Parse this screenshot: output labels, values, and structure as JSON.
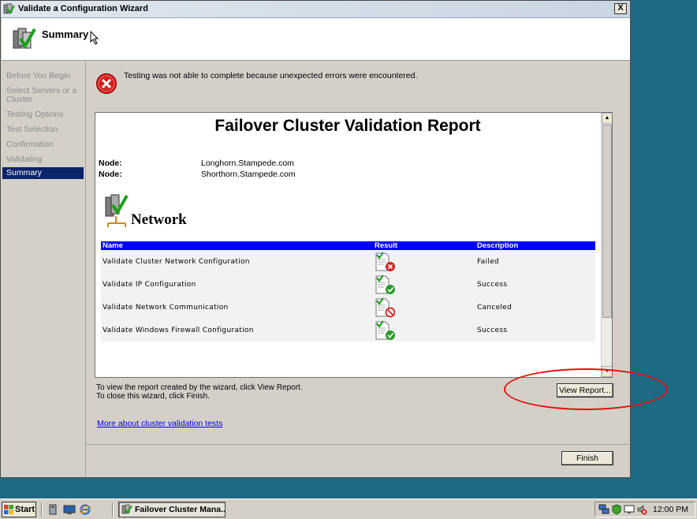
{
  "window": {
    "title": "Validate a Configuration Wizard",
    "close_label": "X",
    "header_title": "Summary"
  },
  "nav": {
    "items": [
      {
        "label": "Before You Begin"
      },
      {
        "label": "Select Servers or a Cluster"
      },
      {
        "label": "Testing Options"
      },
      {
        "label": "Test Selection"
      },
      {
        "label": "Confirmation"
      },
      {
        "label": "Validating"
      },
      {
        "label": "Summary",
        "active": true
      }
    ]
  },
  "status": {
    "message": "Testing was not able to complete because unexpected errors were encountered."
  },
  "report": {
    "title": "Failover Cluster Validation Report",
    "nodes": [
      {
        "label": "Node:",
        "value": "Longhorn.Stampede.com"
      },
      {
        "label": "Node:",
        "value": "Shorthorn.Stampede.com"
      }
    ],
    "section_title": "Network",
    "columns": [
      "Name",
      "Result",
      "Description"
    ],
    "rows": [
      {
        "name": "Validate Cluster Network Configuration",
        "result_icon": "failed-icon",
        "description": "Failed"
      },
      {
        "name": "Validate IP Configuration",
        "result_icon": "success-icon",
        "description": "Success"
      },
      {
        "name": "Validate Network Communication",
        "result_icon": "canceled-icon",
        "description": "Canceled"
      },
      {
        "name": "Validate Windows Firewall Configuration",
        "result_icon": "success-icon",
        "description": "Success"
      }
    ]
  },
  "instructions": {
    "line1": "To view the report created by the wizard, click View Report.",
    "line2": "To close this wizard, click Finish."
  },
  "link": {
    "more": "More about cluster validation tests"
  },
  "buttons": {
    "view_report": "View Report...",
    "finish": "Finish"
  },
  "taskbar": {
    "start": "Start",
    "task": "Failover Cluster Mana...",
    "clock": "12:00 PM"
  },
  "colors": {
    "desktop": "#1d6a85",
    "nav_active": "#0a246a",
    "table_header": "#0000ff",
    "annotation": "#e01010",
    "error": "#d42020"
  }
}
